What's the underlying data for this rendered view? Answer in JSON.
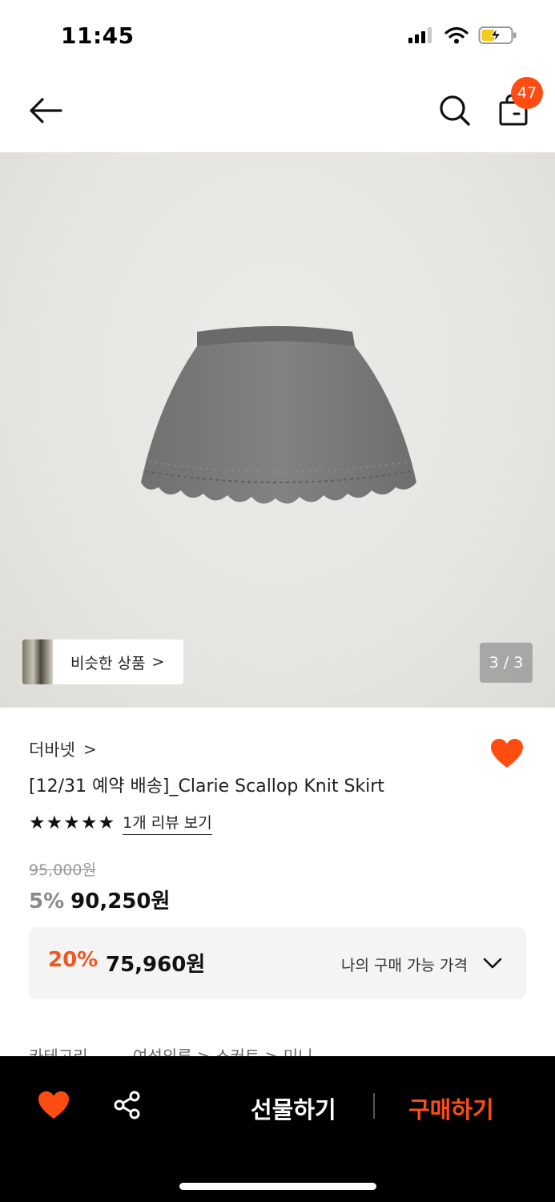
{
  "status_bar": {
    "time": "11:45",
    "icons": [
      "cellular-signal-icon",
      "wifi-icon",
      "battery-charging-icon"
    ]
  },
  "header": {
    "back_icon": "back-arrow-icon",
    "search_icon": "search-icon",
    "bag_icon": "shopping-bag-icon",
    "bag_count": "47"
  },
  "gallery": {
    "similar_label": "비슷한 상품",
    "similar_chevron": ">",
    "counter": "3 / 3"
  },
  "product": {
    "brand": "더바넷",
    "brand_chevron": ">",
    "title": "[12/31 예약 배송]_Clarie Scallop Knit Skirt",
    "rating": 5,
    "review_link": "1개 리뷰 보기",
    "original_price": "95,000원",
    "discount_rate": "5%",
    "sale_price": "90,250원",
    "wishlisted": true
  },
  "my_price": {
    "rate": "20%",
    "price": "75,960원",
    "label": "나의 구매 가능 가격"
  },
  "category": {
    "label": "카테고리",
    "path": "여성의류 > 스커트 > 미니"
  },
  "bottom_bar": {
    "gift_label": "선물하기",
    "buy_label": "구매하기"
  },
  "colors": {
    "accent": "#ff4d12",
    "my_price_rate": "#f0561d",
    "bottom_bar_bg": "#000000"
  }
}
